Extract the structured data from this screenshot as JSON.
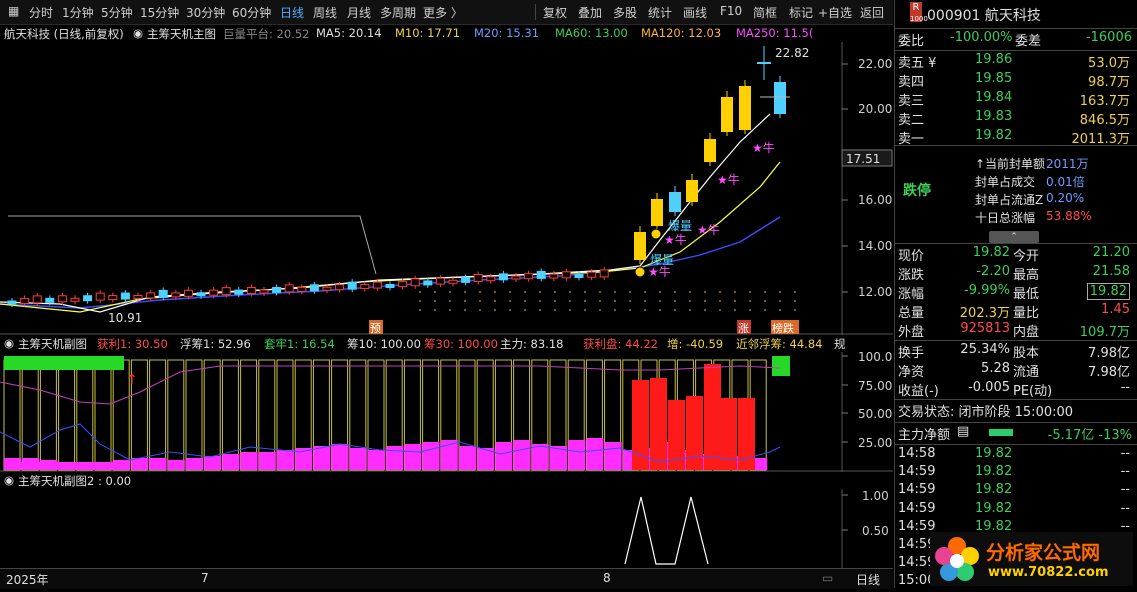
{
  "toolbar": {
    "left": [
      "分时",
      "1分钟",
      "5分钟",
      "15分钟",
      "30分钟",
      "60分钟",
      "日线",
      "周线",
      "月线",
      "多周期",
      "更多 〉"
    ],
    "active": "日线",
    "right": [
      "复权",
      "叠加",
      "多股",
      "统计",
      "画线",
      "F10",
      "简框",
      "标记",
      "+自选",
      "返回"
    ]
  },
  "main_title": {
    "stock": "航天科技 (日线,前复权)",
    "indicator": "主筹天机主图",
    "platform": "巨量平台: 20.52",
    "ma5": "MA5: 20.14",
    "m10": "M10: 17.71",
    "m20": "M20: 15.31",
    "ma60": "MA60: 13.00",
    "ma120": "MA120: 12.03",
    "ma250": "MA250: 11.5("
  },
  "main_axis": [
    "22.00",
    "20.00",
    "18.00",
    "16.00",
    "14.00",
    "12.00"
  ],
  "current_price_tag": "17.51",
  "annotations": {
    "high": "22.82",
    "low": "10.91",
    "breakout1": "爆量",
    "breakout2": "爆量",
    "bull": "牛",
    "pre": "预",
    "up": "涨",
    "list": "榜跌"
  },
  "sub1_title": {
    "name": "主筹天机副图",
    "profit1": "获利1: 30.50",
    "float1": "浮筹1: 52.96",
    "lock": "套牢1: 16.54",
    "chip10": "筹10: 100.00",
    "chip30": "筹30: 100.00",
    "main": "主力: 83.18",
    "profit_disk": "获利盘: 44.22",
    "add": "增: -40.59",
    "near": "近邻浮筹: 44.84",
    "cut": "规"
  },
  "sub1_axis": [
    "100.0",
    "75.00",
    "50.00",
    "25.00"
  ],
  "sub2_title": "主筹天机副图2 : 0.00",
  "sub2_axis": [
    "1.00",
    "0.50"
  ],
  "bottom_axis": {
    "year": "2025年",
    "m7": "7",
    "m8": "8",
    "period": "日线"
  },
  "chart_data": {
    "type": "bar",
    "title": "航天科技 (日线,前复权)",
    "candles_close_recent": [
      13.0,
      14.4,
      16.0,
      17.5,
      19.3,
      20.9,
      20.6,
      21.2
    ]
  },
  "right_panel": {
    "logo_glyph": "R",
    "code_name": "000901 航天科技",
    "weibi": {
      "label": "委比",
      "value": "-100.00%",
      "label2": "委差",
      "value2": "-16006"
    },
    "asks": [
      {
        "label": "卖五 ¥",
        "price": "19.86",
        "vol": "53.0万"
      },
      {
        "label": "卖四",
        "price": "19.85",
        "vol": "98.7万"
      },
      {
        "label": "卖三",
        "price": "19.84",
        "vol": "163.7万"
      },
      {
        "label": "卖二",
        "price": "19.83",
        "vol": "846.5万"
      },
      {
        "label": "卖一",
        "price": "19.82",
        "vol": "2011.3万"
      }
    ],
    "limit_status": "跌停",
    "seal": [
      {
        "label": "↑当前封单额",
        "value": "2011万"
      },
      {
        "label": "封单占成交",
        "value": "0.01倍"
      },
      {
        "label": "封单占流通Z",
        "value": "0.20%"
      },
      {
        "label": "十日总涨幅",
        "value": "53.88%"
      }
    ],
    "quote": [
      {
        "l1": "现价",
        "v1": "19.82",
        "l2": "今开",
        "v2": "21.20"
      },
      {
        "l1": "涨跌",
        "v1": "-2.20",
        "l2": "最高",
        "v2": "21.58"
      },
      {
        "l1": "涨幅",
        "v1": "-9.99%",
        "l2": "最低",
        "v2": "19.82"
      },
      {
        "l1": "总量",
        "v1": "202.3万",
        "l2": "量比",
        "v2": "1.45"
      },
      {
        "l1": "外盘",
        "v1": "925813",
        "l2": "内盘",
        "v2": "109.7万"
      }
    ],
    "stats": [
      {
        "l1": "换手",
        "v1": "25.34%",
        "l2": "股本",
        "v2": "7.98亿"
      },
      {
        "l1": "净资",
        "v1": "5.28",
        "l2": "流通",
        "v2": "7.98亿"
      },
      {
        "l1": "收益(-)",
        "v1": "-0.005",
        "l2": "PE(动)",
        "v2": "--"
      }
    ],
    "trade_status": "交易状态: 闭市阶段 15:00:00",
    "main_net": {
      "label": "主力净额",
      "value": "-5.17亿 -13%"
    },
    "ticks": [
      {
        "t": "14:58",
        "p": "19.82",
        "v": "--"
      },
      {
        "t": "14:59",
        "p": "19.82",
        "v": "--"
      },
      {
        "t": "14:59",
        "p": "19.82",
        "v": "--"
      },
      {
        "t": "14:59",
        "p": "19.82",
        "v": "--"
      },
      {
        "t": "14:59",
        "p": "19.82",
        "v": "--"
      },
      {
        "t": "14:59",
        "p": "",
        "v": ""
      },
      {
        "t": "14:59",
        "p": "",
        "v": ""
      },
      {
        "t": "15:00",
        "p": "",
        "v": ""
      }
    ],
    "watermark": {
      "text": "分析家公式网",
      "url": "www.70822.com"
    }
  }
}
